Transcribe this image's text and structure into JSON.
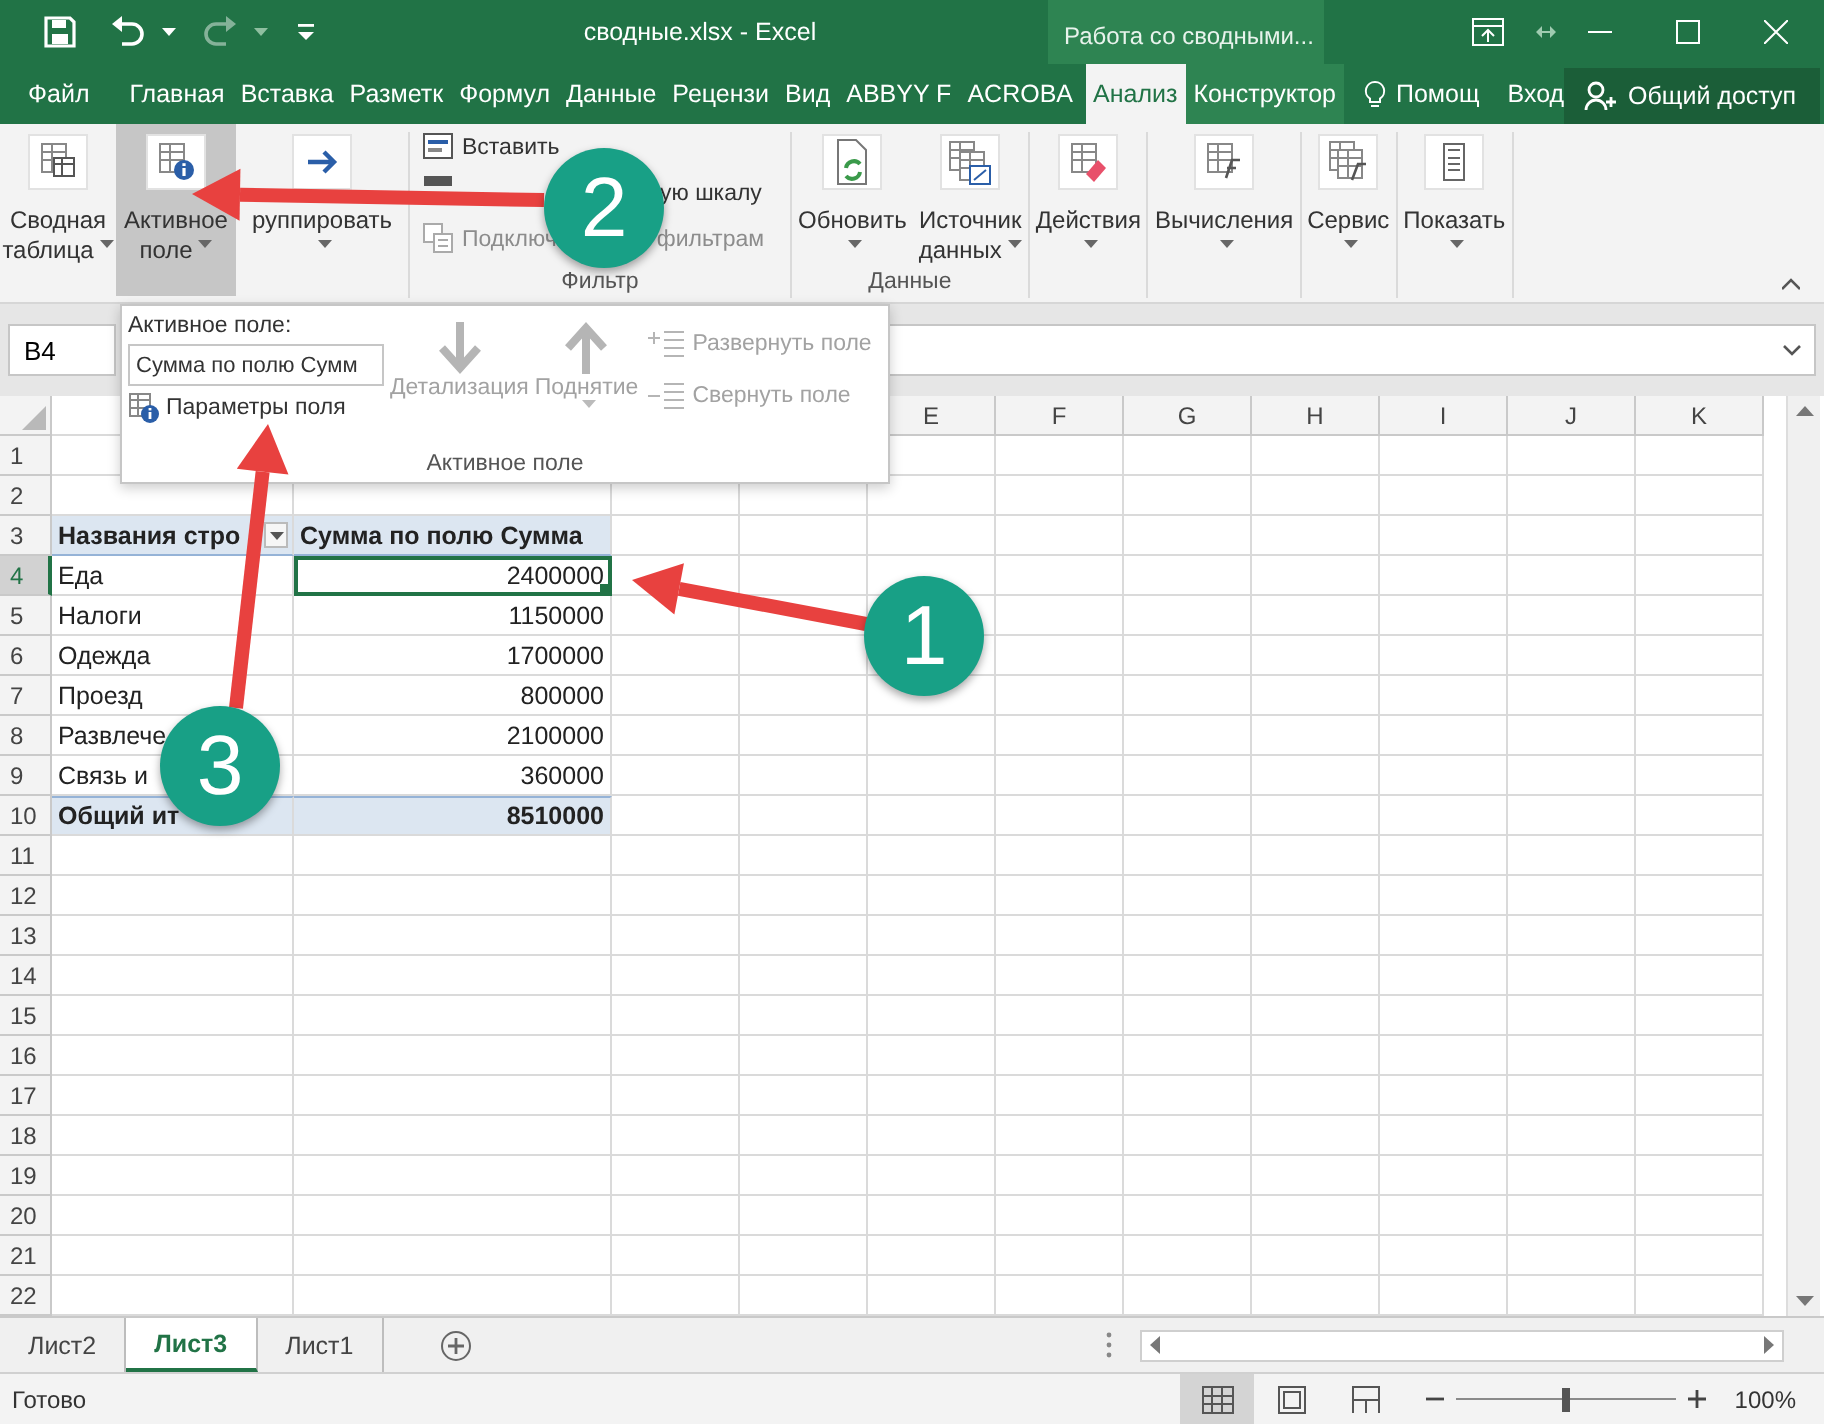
{
  "title_bar": {
    "title": "сводные.xlsx - Excel",
    "context_group": "Работа со сводными..."
  },
  "ribbon_tabs": [
    {
      "label": "Файл",
      "kind": "file",
      "selected": false
    },
    {
      "label": "Главная",
      "kind": "main",
      "selected": false
    },
    {
      "label": "Вставка",
      "kind": "main",
      "selected": false
    },
    {
      "label": "Разметк",
      "kind": "main",
      "selected": false
    },
    {
      "label": "Формул",
      "kind": "main",
      "selected": false
    },
    {
      "label": "Данные",
      "kind": "main",
      "selected": false
    },
    {
      "label": "Рецензи",
      "kind": "main",
      "selected": false
    },
    {
      "label": "Вид",
      "kind": "main",
      "selected": false
    },
    {
      "label": "ABBYY F",
      "kind": "main",
      "selected": false
    },
    {
      "label": "ACROBA",
      "kind": "main",
      "selected": false
    },
    {
      "label": "Анализ",
      "kind": "context",
      "selected": true
    },
    {
      "label": "Конструктор",
      "kind": "context",
      "selected": false
    }
  ],
  "tell_me": "Помощ",
  "sign_in": "Вход",
  "share": "Общий доступ",
  "ribbon": {
    "groups": [
      {
        "kind": "large",
        "buttons": [
          {
            "kind": "pivot",
            "lines": [
              "Сводная",
              "таблица"
            ],
            "dropdown": true,
            "pressed": false
          }
        ]
      },
      {
        "kind": "large",
        "buttons": [
          {
            "kind": "field",
            "lines": [
              "Активное",
              "поле"
            ],
            "dropdown": true,
            "pressed": true
          }
        ]
      },
      {
        "kind": "large",
        "buttons": [
          {
            "kind": "group",
            "lines": [
              "руппировать"
            ],
            "dropdown": true,
            "pressed": false
          }
        ]
      },
      {
        "kind": "stack",
        "label": "Фильтр",
        "buttons": [
          {
            "kind": "slicer",
            "parts": [
              "Вставить"
            ],
            "disabled": false
          },
          {
            "kind": "timeline",
            "parts": [
              "ую шкалу"
            ],
            "disabled": false
          },
          {
            "kind": "connections",
            "parts": [
              "Подключ",
              "фильтрам"
            ],
            "disabled": true
          }
        ]
      },
      {
        "kind": "large",
        "label": "Данные",
        "buttons": [
          {
            "kind": "refresh",
            "lines": [
              "Обновить"
            ],
            "dropdown": true,
            "pressed": false
          },
          {
            "kind": "source",
            "lines": [
              "Источник",
              "данных"
            ],
            "dropdown": true,
            "pressed": false
          }
        ]
      },
      {
        "kind": "large",
        "buttons": [
          {
            "kind": "actions",
            "lines": [
              "Действия"
            ],
            "dropdown": true,
            "pressed": false
          }
        ]
      },
      {
        "kind": "large",
        "buttons": [
          {
            "kind": "calc",
            "lines": [
              "Вычисления"
            ],
            "dropdown": true,
            "pressed": false
          }
        ]
      },
      {
        "kind": "large",
        "buttons": [
          {
            "kind": "tools",
            "lines": [
              "Сервис"
            ],
            "dropdown": true,
            "pressed": false
          }
        ]
      },
      {
        "kind": "large",
        "buttons": [
          {
            "kind": "show",
            "lines": [
              "Показать"
            ],
            "dropdown": true,
            "pressed": false
          }
        ]
      }
    ]
  },
  "name_box": "B4",
  "popup": {
    "label": "Активное поле:",
    "field_value": "Сумма по полю Сумм",
    "settings": "Параметры поля",
    "actions": [
      {
        "kind": "drilldown",
        "label": "Детализация",
        "dropdown": false,
        "disabled": true
      },
      {
        "kind": "drillup",
        "label": "Поднятие",
        "dropdown": true,
        "disabled": true
      }
    ],
    "outline": [
      {
        "kind": "expand",
        "label": "Развернуть поле",
        "disabled": true
      },
      {
        "kind": "collapse",
        "label": "Свернуть поле",
        "disabled": true
      }
    ],
    "group_label": "Активное поле"
  },
  "sheet": {
    "columns": [
      "E",
      "F",
      "G",
      "H",
      "I",
      "J",
      "K"
    ],
    "rows": [
      {
        "number": "1",
        "kind": "blank",
        "selected": false
      },
      {
        "number": "2",
        "kind": "blank",
        "selected": false
      },
      {
        "number": "3",
        "kind": "header",
        "selected": false,
        "cells": [
          {
            "text": "Названия стро",
            "filter": true,
            "selected": false
          },
          {
            "text": "Сумма по полю Сумма",
            "filter": false,
            "selected": false
          }
        ]
      },
      {
        "number": "4",
        "kind": "item",
        "selected": true,
        "cells": [
          {
            "text": "Еда",
            "selected": false
          },
          {
            "text": "2400000",
            "selected": true
          }
        ]
      },
      {
        "number": "5",
        "kind": "item",
        "selected": false,
        "cells": [
          {
            "text": "Налоги",
            "selected": false
          },
          {
            "text": "1150000",
            "selected": false
          }
        ]
      },
      {
        "number": "6",
        "kind": "item",
        "selected": false,
        "cells": [
          {
            "text": "Одежда",
            "selected": false
          },
          {
            "text": "1700000",
            "selected": false
          }
        ]
      },
      {
        "number": "7",
        "kind": "item",
        "selected": false,
        "cells": [
          {
            "text": "Проезд",
            "selected": false
          },
          {
            "text": "800000",
            "selected": false
          }
        ]
      },
      {
        "number": "8",
        "kind": "item",
        "selected": false,
        "cells": [
          {
            "text": "Развлече",
            "selected": false
          },
          {
            "text": "2100000",
            "selected": false
          }
        ]
      },
      {
        "number": "9",
        "kind": "item",
        "selected": false,
        "cells": [
          {
            "text": "Связь и",
            "selected": false
          },
          {
            "text": "360000",
            "selected": false
          }
        ]
      },
      {
        "number": "10",
        "kind": "total",
        "selected": false,
        "cells": [
          {
            "text": "Общий ит",
            "selected": false
          },
          {
            "text": "8510000",
            "selected": false
          }
        ]
      },
      {
        "number": "11",
        "kind": "blank",
        "selected": false
      },
      {
        "number": "12",
        "kind": "blank",
        "selected": false
      },
      {
        "number": "13",
        "kind": "blank",
        "selected": false
      },
      {
        "number": "14",
        "kind": "blank",
        "selected": false
      },
      {
        "number": "15",
        "kind": "blank",
        "selected": false
      },
      {
        "number": "16",
        "kind": "blank",
        "selected": false
      },
      {
        "number": "17",
        "kind": "blank",
        "selected": false
      },
      {
        "number": "18",
        "kind": "blank",
        "selected": false
      },
      {
        "number": "19",
        "kind": "blank",
        "selected": false
      },
      {
        "number": "20",
        "kind": "blank",
        "selected": false
      },
      {
        "number": "21",
        "kind": "blank",
        "selected": false
      },
      {
        "number": "22",
        "kind": "blank",
        "selected": false
      }
    ]
  },
  "sheet_tabs": [
    {
      "label": "Лист2",
      "selected": false
    },
    {
      "label": "Лист3",
      "selected": true
    },
    {
      "label": "Лист1",
      "selected": false
    }
  ],
  "status_bar": {
    "status": "Готово",
    "views": [
      {
        "kind": "normal",
        "selected": true
      },
      {
        "kind": "layout",
        "selected": false
      },
      {
        "kind": "pagebreak",
        "selected": false
      }
    ],
    "zoom": {
      "level": 0.5,
      "reading": "100%"
    }
  },
  "annotations": [
    {
      "label": "1"
    },
    {
      "label": "2"
    },
    {
      "label": "3"
    }
  ]
}
